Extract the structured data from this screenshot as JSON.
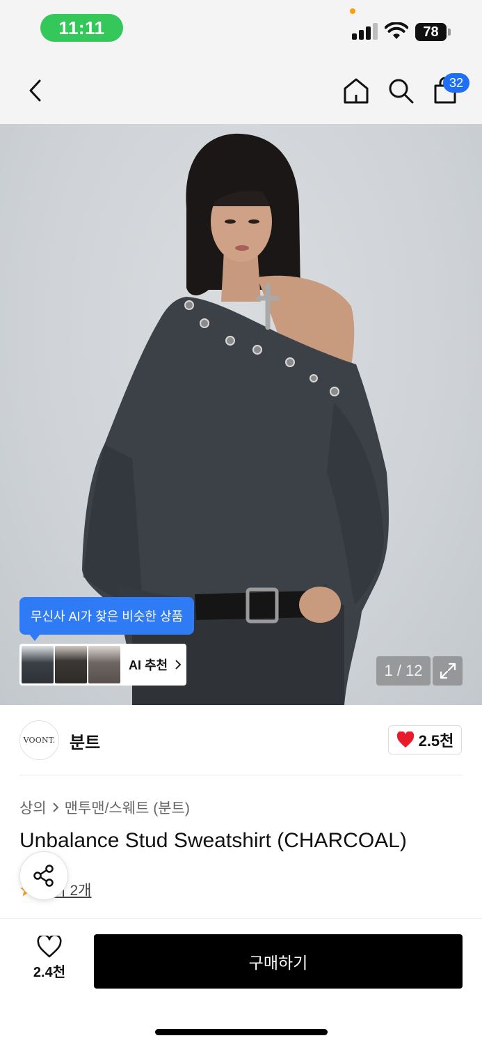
{
  "status_bar": {
    "time": "11:11",
    "battery": "78"
  },
  "nav": {
    "cart_badge": "32"
  },
  "product_image": {
    "ai_tooltip": "무신사 AI가 찾은 비슷한 상품",
    "ai_recommend_label": "AI 추천",
    "pager": "1 / 12"
  },
  "brand": {
    "logo_text": "VOONT.",
    "name": "분트",
    "likes": "2.5천"
  },
  "breadcrumb": {
    "items": [
      "상의",
      "맨투맨/스웨트 (분트)"
    ]
  },
  "product": {
    "title": "Unbalance Stud Sweatshirt (CHARCOAL)",
    "reviews": "후기 2개"
  },
  "bottom_bar": {
    "wish_count": "2.4천",
    "buy_label": "구매하기"
  },
  "colors": {
    "accent_blue": "#2f7bf5",
    "time_pill_green": "#34c759",
    "heart_red": "#e81b2b",
    "buy_button": "#000000"
  },
  "icons": [
    "back-chevron-icon",
    "home-icon",
    "search-icon",
    "shopping-bag-icon",
    "expand-icon",
    "heart-icon",
    "share-icon",
    "star-icon",
    "chevron-right-icon"
  ]
}
